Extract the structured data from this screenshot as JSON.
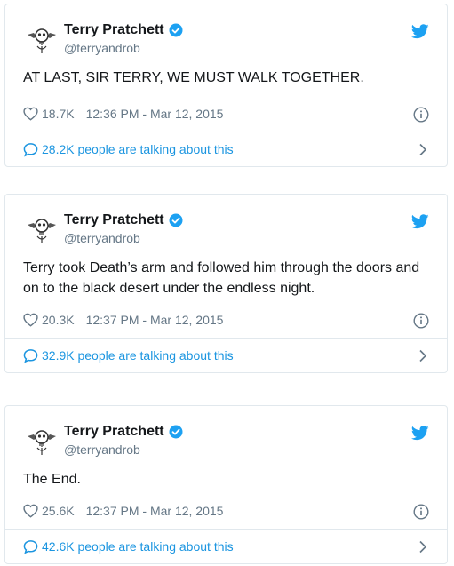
{
  "colors": {
    "accent": "#1da1f2",
    "link": "#1b95e0",
    "muted": "#657786",
    "border": "#e1e8ed"
  },
  "icons": {
    "avatar": "skull-avatar-icon",
    "verified": "verified-badge-icon",
    "bird": "twitter-bird-icon",
    "heart": "heart-icon",
    "info": "info-icon",
    "bubble": "speech-bubble-icon",
    "chevron": "chevron-right-icon"
  },
  "tweets": [
    {
      "name": "Terry Pratchett",
      "handle": "@terryandrob",
      "text": "AT LAST, SIR TERRY, WE MUST WALK TOGETHER.",
      "likes": "18.7K",
      "timestamp": "12:36 PM - Mar 12, 2015",
      "talking": "28.2K people are talking about this"
    },
    {
      "name": "Terry Pratchett",
      "handle": "@terryandrob",
      "text": "Terry took Death’s arm and followed him through the doors and on to the black desert under the endless night.",
      "likes": "20.3K",
      "timestamp": "12:37 PM - Mar 12, 2015",
      "talking": "32.9K people are talking about this"
    },
    {
      "name": "Terry Pratchett",
      "handle": "@terryandrob",
      "text": "The End.",
      "likes": "25.6K",
      "timestamp": "12:37 PM - Mar 12, 2015",
      "talking": "42.6K people are talking about this"
    }
  ]
}
